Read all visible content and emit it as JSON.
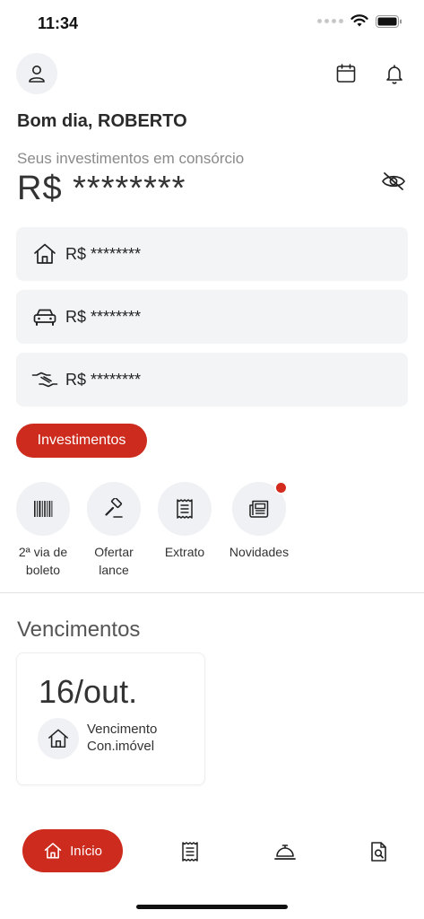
{
  "status_bar": {
    "time": "11:34"
  },
  "header": {
    "greeting": "Bom dia, ROBERTO"
  },
  "investments": {
    "label": "Seus investimentos em consórcio",
    "balance": "R$ ********",
    "cards": [
      {
        "icon": "house-icon",
        "value": "R$ ********"
      },
      {
        "icon": "car-icon",
        "value": "R$ ********"
      },
      {
        "icon": "handshake-icon",
        "value": "R$ ********"
      }
    ],
    "button_label": "Investimentos"
  },
  "quick_actions": [
    {
      "icon": "barcode-icon",
      "line1": "2ª via de",
      "line2": "boleto"
    },
    {
      "icon": "gavel-icon",
      "line1": "Ofertar",
      "line2": "lance"
    },
    {
      "icon": "receipt-icon",
      "line1": "Extrato",
      "line2": ""
    },
    {
      "icon": "newspaper-icon",
      "line1": "Novidades",
      "line2": ""
    }
  ],
  "due": {
    "title": "Vencimentos",
    "date": "16/out.",
    "line1": "Vencimento",
    "line2": "Con.imóvel"
  },
  "tabbar": {
    "home_label": "Início"
  },
  "colors": {
    "accent": "#cc2b1d",
    "card_bg": "#f3f4f6"
  }
}
